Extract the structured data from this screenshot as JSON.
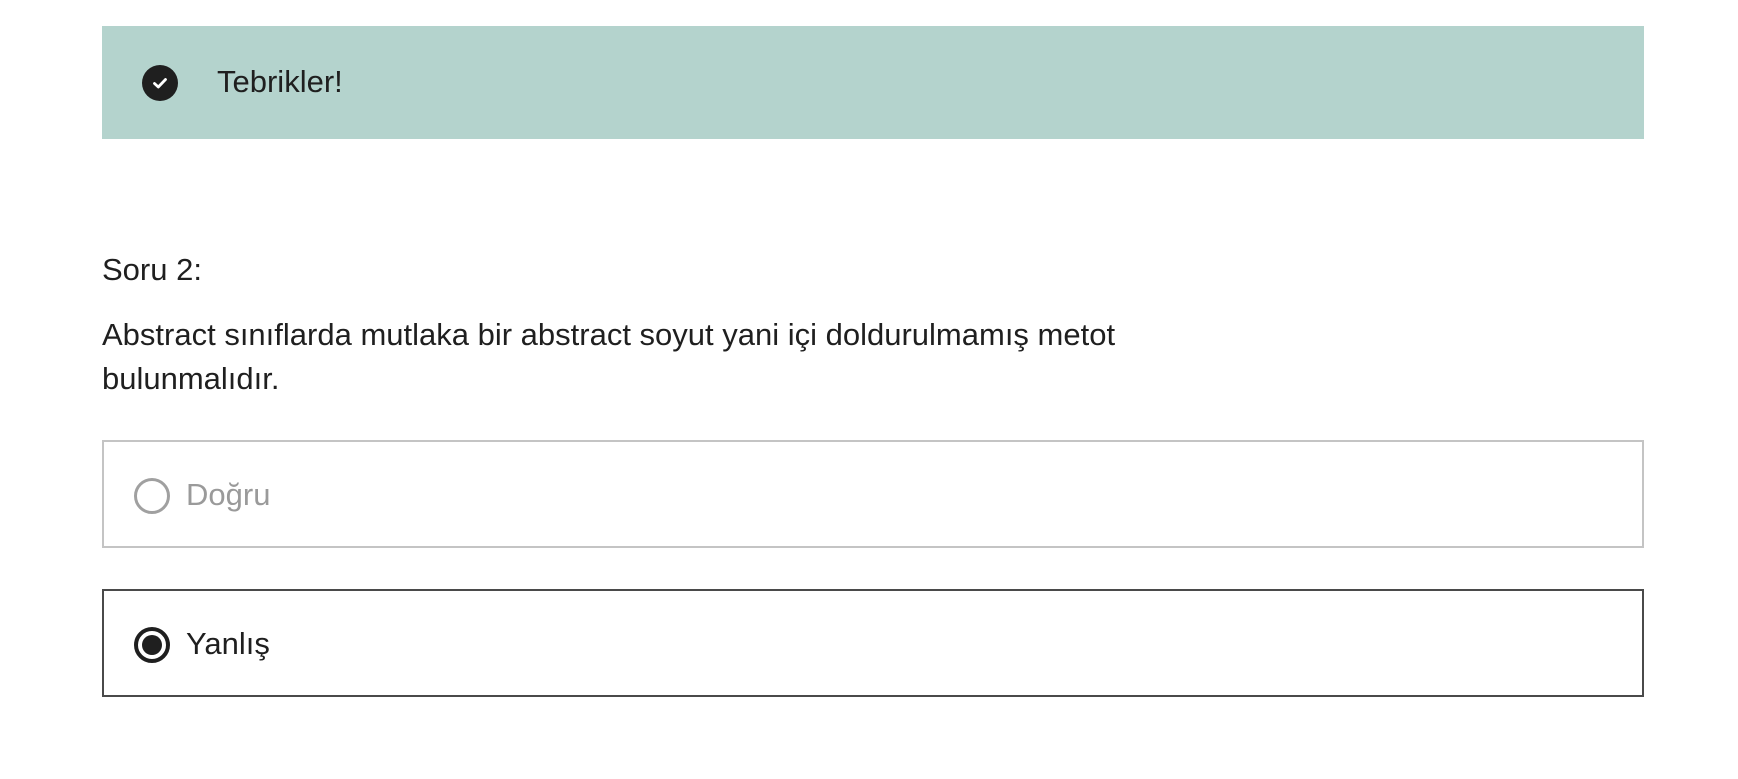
{
  "alert": {
    "message": "Tebrikler!",
    "icon": "check-circle-icon",
    "background": "#b4d3cd"
  },
  "question": {
    "number_label": "Soru 2:",
    "text": "Abstract sınıflarda mutlaka bir abstract soyut yani içi doldurulmamış metot bulunmalıdır."
  },
  "options": [
    {
      "label": "Doğru",
      "selected": false
    },
    {
      "label": "Yanlış",
      "selected": true
    }
  ]
}
